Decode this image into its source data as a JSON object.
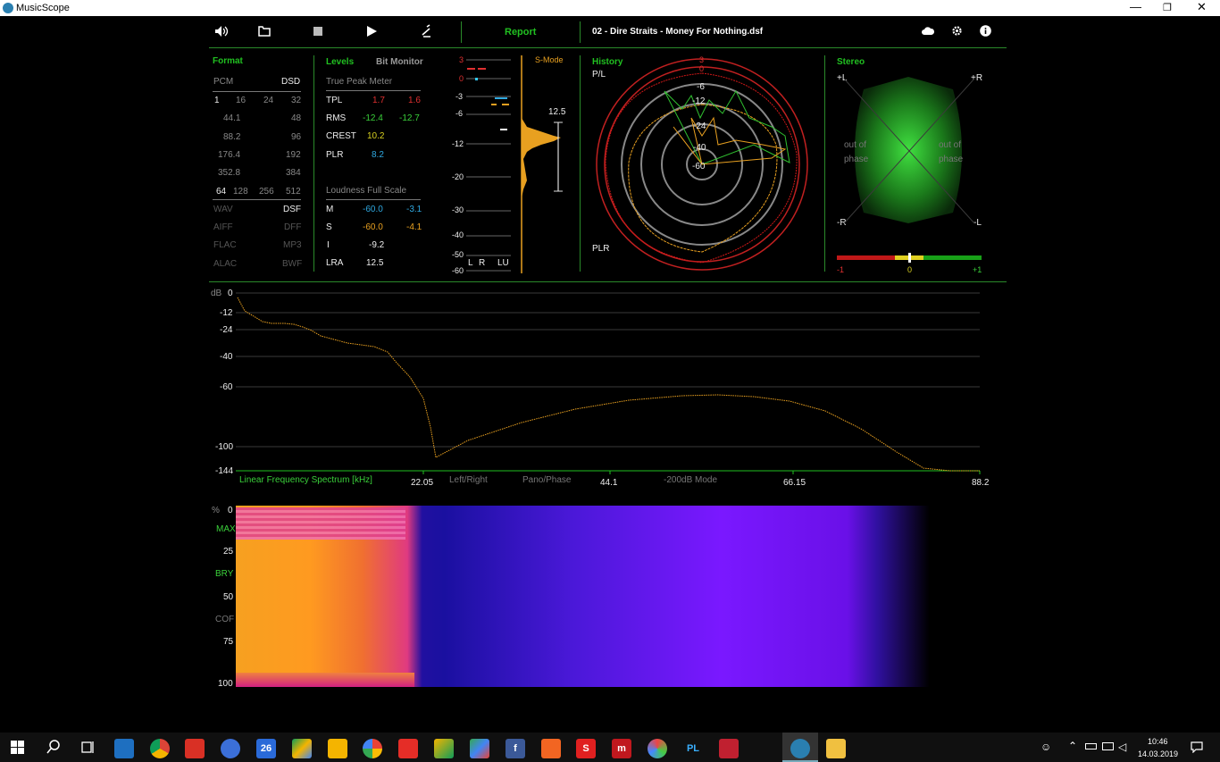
{
  "window": {
    "title": "MusicScope"
  },
  "toolbar": {
    "report_label": "Report",
    "file_name": "02 - Dire Straits - Money For Nothing.dsf"
  },
  "format": {
    "title": "Format",
    "pcm": "PCM",
    "dsd": "DSD",
    "bits": [
      "1",
      "16",
      "24",
      "32"
    ],
    "rates": [
      [
        "44.1",
        "48"
      ],
      [
        "88.2",
        "96"
      ],
      [
        "176.4",
        "192"
      ],
      [
        "352.8",
        "384"
      ]
    ],
    "dsd_rates": [
      "64",
      "128",
      "256",
      "512"
    ],
    "types": [
      [
        "WAV",
        "DSF"
      ],
      [
        "AIFF",
        "DFF"
      ],
      [
        "FLAC",
        "MP3"
      ],
      [
        "ALAC",
        "BWF"
      ]
    ]
  },
  "levels": {
    "title": "Levels",
    "bitmonitor": "Bit Monitor",
    "tpm_title": "True Peak Meter",
    "rows": [
      {
        "label": "TPL",
        "l": "1.7",
        "r": "1.6"
      },
      {
        "label": "RMS",
        "l": "-12.4",
        "r": "-12.7"
      },
      {
        "label": "CREST",
        "l": "10.2"
      },
      {
        "label": "PLR",
        "l": "8.2"
      }
    ],
    "lfs_title": "Loudness Full Scale",
    "lfs_rows": [
      {
        "label": "M",
        "a": "-60.0",
        "b": "-3.1"
      },
      {
        "label": "S",
        "a": "-60.0",
        "b": "-4.1"
      },
      {
        "label": "I",
        "a": "-9.2"
      },
      {
        "label": "LRA",
        "a": "12.5"
      }
    ]
  },
  "meter": {
    "ticks": [
      "3",
      "0",
      "-3",
      "-6",
      "-12",
      "-20",
      "-30",
      "-40",
      "-50",
      "-60"
    ],
    "smode": "S-Mode",
    "lra_value": "12.5",
    "bottom": {
      "l": "L",
      "r": "R",
      "lu": "LU"
    }
  },
  "history": {
    "title": "History",
    "pl": "P/L",
    "plr": "PLR",
    "rings": [
      "3",
      "0",
      "-6",
      "-12",
      "-24",
      "-40",
      "-60"
    ]
  },
  "stereo": {
    "title": "Stereo",
    "pl": "+L",
    "pr": "+R",
    "mr": "-R",
    "ml": "-L",
    "oop_left": "out of\nphase",
    "oop_right": "out of\nphase",
    "scale": [
      "-1",
      "0",
      "+1"
    ]
  },
  "spectrum": {
    "db_label": "dB",
    "y_ticks": [
      "0",
      "-12",
      "-24",
      "-40",
      "-60",
      "-100",
      "-144"
    ],
    "title": "Linear Frequency Spectrum [kHz]",
    "x_ticks": [
      "22.05",
      "44.1",
      "66.15",
      "88.2"
    ],
    "modes": [
      "Left/Right",
      "Pano/Phase",
      "-200dB Mode"
    ]
  },
  "spectrogram": {
    "pct": "%",
    "y_labels": [
      "0",
      "MAX",
      "25",
      "BRY",
      "50",
      "COF",
      "75",
      "100"
    ]
  },
  "taskbar": {
    "time": "10:46",
    "date": "14.03.2019",
    "cal_day": "26"
  },
  "colors": {
    "accent": "#21c021",
    "spectrum_line": "#e8a020",
    "panel_border": "#2a8a2a"
  }
}
